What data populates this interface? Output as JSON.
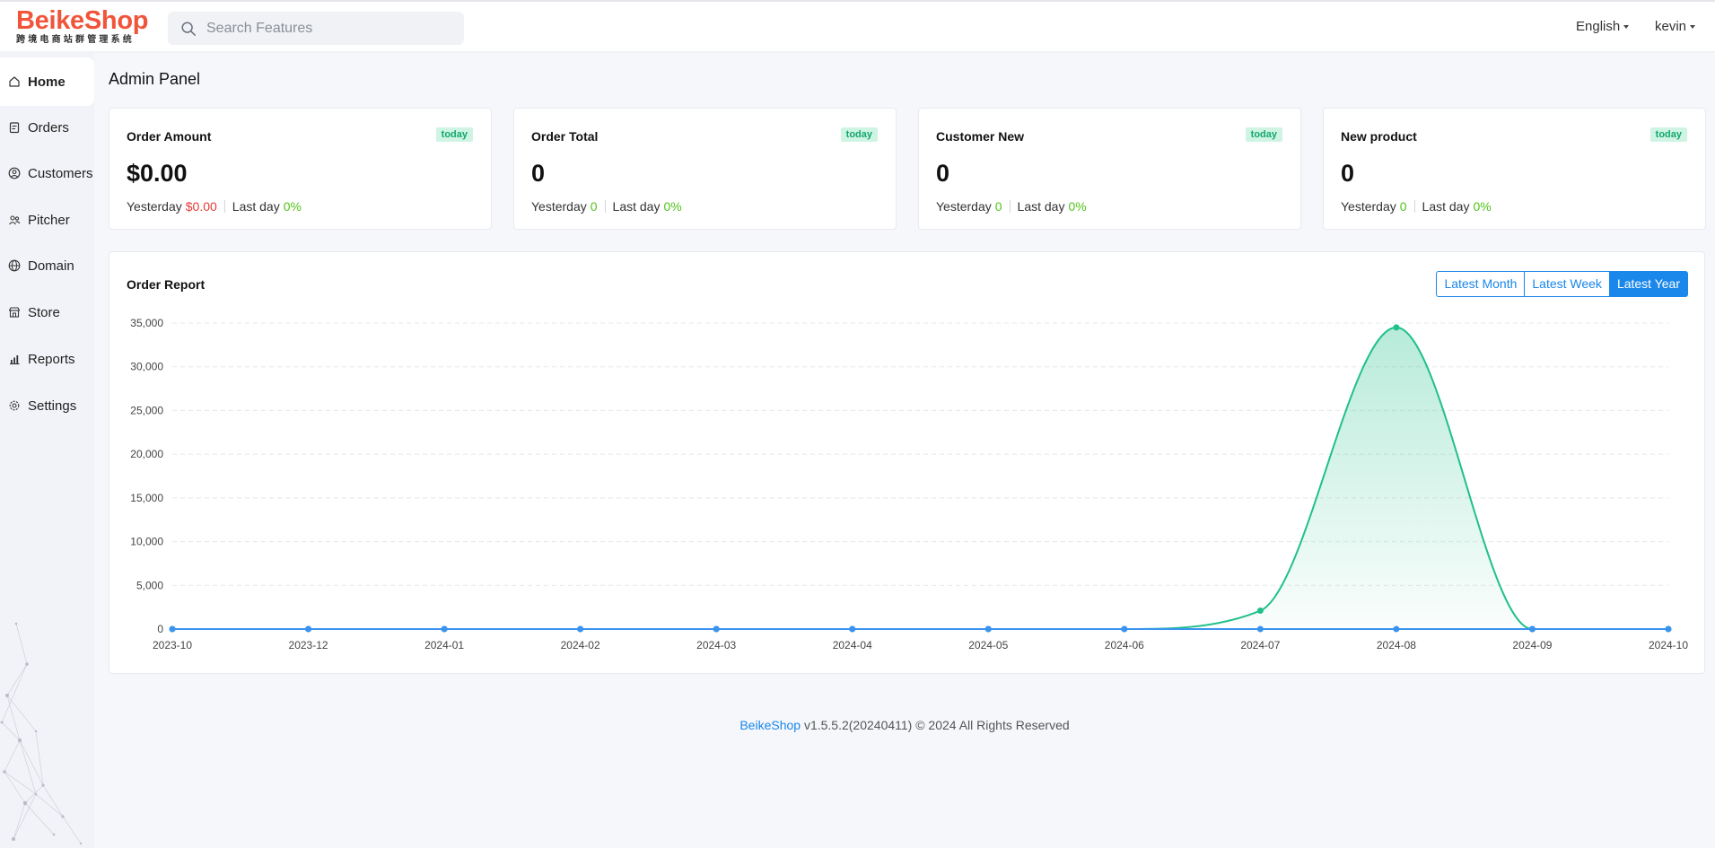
{
  "header": {
    "logo_name": "BeikeShop",
    "logo_tagline": "跨境电商站群管理系统",
    "search_placeholder": "Search Features",
    "language": "English",
    "user": "kevin"
  },
  "sidebar": {
    "items": [
      {
        "label": "Home",
        "icon": "home-icon",
        "active": true
      },
      {
        "label": "Orders",
        "icon": "orders-icon",
        "active": false
      },
      {
        "label": "Customers",
        "icon": "customers-icon",
        "active": false
      },
      {
        "label": "Pitcher",
        "icon": "pitcher-icon",
        "active": false
      },
      {
        "label": "Domain",
        "icon": "globe-icon",
        "active": false
      },
      {
        "label": "Store",
        "icon": "store-icon",
        "active": false
      },
      {
        "label": "Reports",
        "icon": "reports-icon",
        "active": false
      },
      {
        "label": "Settings",
        "icon": "gear-icon",
        "active": false
      }
    ]
  },
  "page": {
    "title": "Admin Panel"
  },
  "stats": [
    {
      "title": "Order Amount",
      "badge": "today",
      "value": "$0.00",
      "yesterday_label": "Yesterday",
      "yesterday_value": "$0.00",
      "lastday_label": "Last day",
      "lastday_value": "0%",
      "yesterday_color": "#e53935"
    },
    {
      "title": "Order Total",
      "badge": "today",
      "value": "0",
      "yesterday_label": "Yesterday",
      "yesterday_value": "0",
      "lastday_label": "Last day",
      "lastday_value": "0%",
      "yesterday_color": "#52c41a"
    },
    {
      "title": "Customer New",
      "badge": "today",
      "value": "0",
      "yesterday_label": "Yesterday",
      "yesterday_value": "0",
      "lastday_label": "Last day",
      "lastday_value": "0%",
      "yesterday_color": "#52c41a"
    },
    {
      "title": "New product",
      "badge": "today",
      "value": "0",
      "yesterday_label": "Yesterday",
      "yesterday_value": "0",
      "lastday_label": "Last day",
      "lastday_value": "0%",
      "yesterday_color": "#52c41a"
    }
  ],
  "report": {
    "title": "Order Report",
    "buttons": [
      {
        "label": "Latest Month",
        "active": false
      },
      {
        "label": "Latest Week",
        "active": false
      },
      {
        "label": "Latest Year",
        "active": true
      }
    ]
  },
  "chart_data": {
    "type": "line",
    "title": "Order Report",
    "categories": [
      "2023-10",
      "2023-12",
      "2024-01",
      "2024-02",
      "2024-03",
      "2024-04",
      "2024-05",
      "2024-06",
      "2024-07",
      "2024-08",
      "2024-09",
      "2024-10"
    ],
    "series": [
      {
        "values": [
          0,
          0,
          0,
          0,
          0,
          0,
          0,
          0,
          2100,
          34500,
          0,
          0
        ],
        "color": "#20c08a",
        "area": true
      },
      {
        "values": [
          0,
          0,
          0,
          0,
          0,
          0,
          0,
          0,
          0,
          0,
          0,
          0
        ],
        "color": "#3b93f0",
        "area": false
      }
    ],
    "ylim": [
      0,
      35000
    ],
    "yticks": [
      0,
      5000,
      10000,
      15000,
      20000,
      25000,
      30000,
      35000
    ],
    "ytick_labels": [
      "0",
      "5,000",
      "10,000",
      "15,000",
      "20,000",
      "25,000",
      "30,000",
      "35,000"
    ],
    "grid": true
  },
  "footer": {
    "brand": "BeikeShop",
    "text": "v1.5.5.2(20240411) © 2024 All Rights Reserved"
  }
}
